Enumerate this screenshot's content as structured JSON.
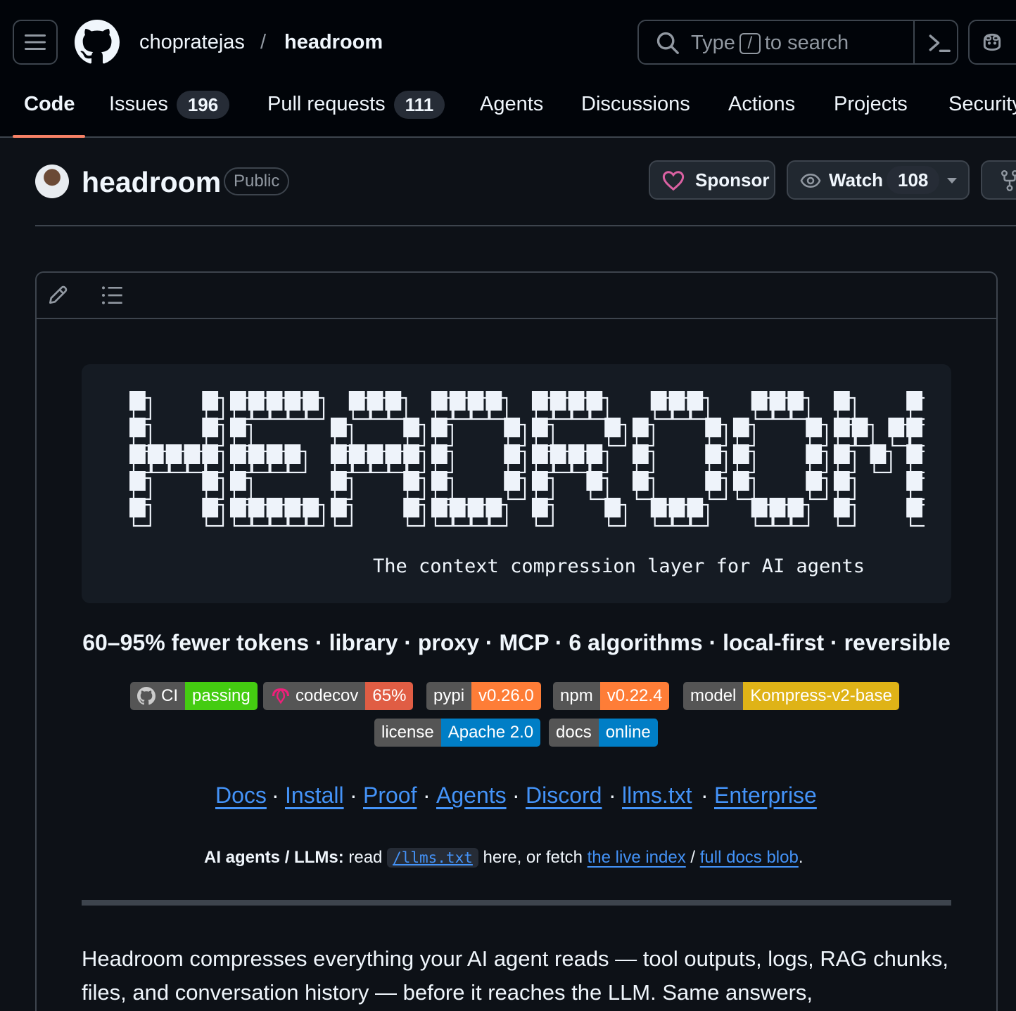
{
  "header": {
    "owner": "chopratejas",
    "separator": "/",
    "repo": "headroom",
    "search": {
      "prefix": "Type",
      "key": "/",
      "suffix": "to search"
    }
  },
  "tabs": [
    {
      "label": "Code",
      "active": true
    },
    {
      "label": "Issues",
      "count": "196"
    },
    {
      "label": "Pull requests",
      "count": "111"
    },
    {
      "label": "Agents"
    },
    {
      "label": "Discussions"
    },
    {
      "label": "Actions"
    },
    {
      "label": "Projects"
    },
    {
      "label": "Security"
    }
  ],
  "repo": {
    "name": "headroom",
    "visibility": "Public",
    "sponsor_label": "Sponsor",
    "watch_label": "Watch",
    "watch_count": "108"
  },
  "readme": {
    "ascii_word": "HEADROOM",
    "tagline": "The context compression layer for AI agents",
    "subtitle": "60–95% fewer tokens · library · proxy · MCP · 6 algorithms · local-first · reversible",
    "badges_row1": [
      {
        "label": "CI",
        "value": "passing",
        "color": "#4c1",
        "icon": "github-icon"
      },
      {
        "label": "codecov",
        "value": "65%",
        "color": "#e05d44",
        "icon": "codecov-icon"
      },
      {
        "label": "pypi",
        "value": "v0.26.0",
        "color": "#fe7d37"
      },
      {
        "label": "npm",
        "value": "v0.22.4",
        "color": "#fe7d37"
      },
      {
        "label": "model",
        "value": "Kompress-v2-base",
        "color": "#dfb317"
      }
    ],
    "badges_row2": [
      {
        "label": "license",
        "value": "Apache 2.0",
        "color": "#007ec6"
      },
      {
        "label": "docs",
        "value": "online",
        "color": "#007ec6"
      }
    ],
    "links": [
      "Docs",
      "Install",
      "Proof",
      "Agents",
      "Discord",
      "llms.txt",
      "Enterprise"
    ],
    "link_separator": "·",
    "ai_line": {
      "bold": "AI agents / LLMs:",
      "read": "read",
      "code": "/llms.txt",
      "middle": "here, or fetch",
      "link1": "the live index",
      "slash": "/",
      "link2": "full docs blob",
      "end": "."
    },
    "body": "Headroom compresses everything your AI agent reads — tool outputs, logs, RAG chunks, files, and conversation history — before it reaches the LLM. Same answers,"
  },
  "colors": {
    "accent": "#4493f8",
    "tab_underline": "#f78166",
    "badge_left": "#555555"
  }
}
